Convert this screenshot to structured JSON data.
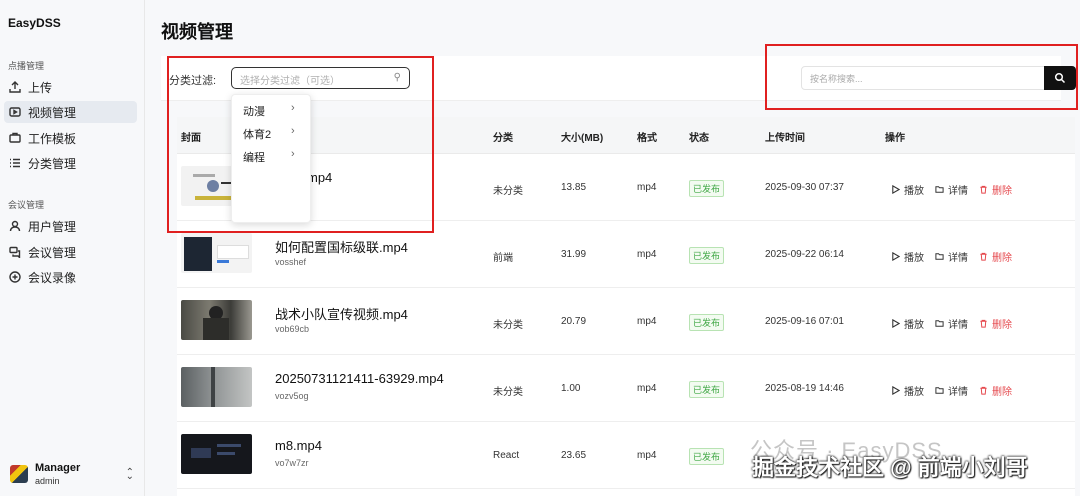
{
  "app": {
    "name": "EasyDSS"
  },
  "sidebar": {
    "sections": [
      {
        "title": "点播管理",
        "items": [
          {
            "label": "上传",
            "icon": "upload-icon"
          },
          {
            "label": "视频管理",
            "icon": "video-icon",
            "active": true
          },
          {
            "label": "工作模板",
            "icon": "template-icon"
          },
          {
            "label": "分类管理",
            "icon": "list-icon"
          }
        ]
      },
      {
        "title": "会议管理",
        "items": [
          {
            "label": "用户管理",
            "icon": "user-icon"
          },
          {
            "label": "会议管理",
            "icon": "meeting-icon"
          },
          {
            "label": "会议录像",
            "icon": "record-icon"
          }
        ]
      }
    ],
    "user": {
      "name": "Manager",
      "role": "admin"
    }
  },
  "page": {
    "title": "视频管理"
  },
  "filter": {
    "label": "分类过滤:",
    "placeholder": "选择分类过滤（可选）",
    "options": [
      "动漫",
      "体育2",
      "编程"
    ]
  },
  "search": {
    "placeholder": "按名称搜索..."
  },
  "table": {
    "headers": [
      "封面",
      "分类",
      "大小(MB)",
      "格式",
      "状态",
      "上传时间",
      "操作"
    ],
    "actions": {
      "play": "播放",
      "detail": "详情",
      "delete": "删除"
    },
    "rows": [
      {
        "name": "mp4",
        "code": "",
        "category": "未分类",
        "size": "13.85",
        "format": "mp4",
        "status": "已发布",
        "time": "2025-09-30 07:37"
      },
      {
        "name": "如何配置国标级联.mp4",
        "code": "vosshef",
        "category": "前端",
        "size": "31.99",
        "format": "mp4",
        "status": "已发布",
        "time": "2025-09-22 06:14"
      },
      {
        "name": "战术小队宣传视频.mp4",
        "code": "vob69cb",
        "category": "未分类",
        "size": "20.79",
        "format": "mp4",
        "status": "已发布",
        "time": "2025-09-16 07:01"
      },
      {
        "name": "20250731121411-63929.mp4",
        "code": "vozv5og",
        "category": "未分类",
        "size": "1.00",
        "format": "mp4",
        "status": "已发布",
        "time": "2025-08-19 14:46"
      },
      {
        "name": "m8.mp4",
        "code": "vo7w7zr",
        "category": "React",
        "size": "23.65",
        "format": "mp4",
        "status": "已发布",
        "time": ""
      }
    ]
  },
  "watermark": {
    "line1": "公众号 · EasyDSS",
    "line2": "掘金技术社区 @ 前端小刘哥"
  },
  "colors": {
    "accent": "#111111",
    "highlight_box": "#e02020",
    "status_green": "#3fa744",
    "delete_red": "#e5484d"
  }
}
